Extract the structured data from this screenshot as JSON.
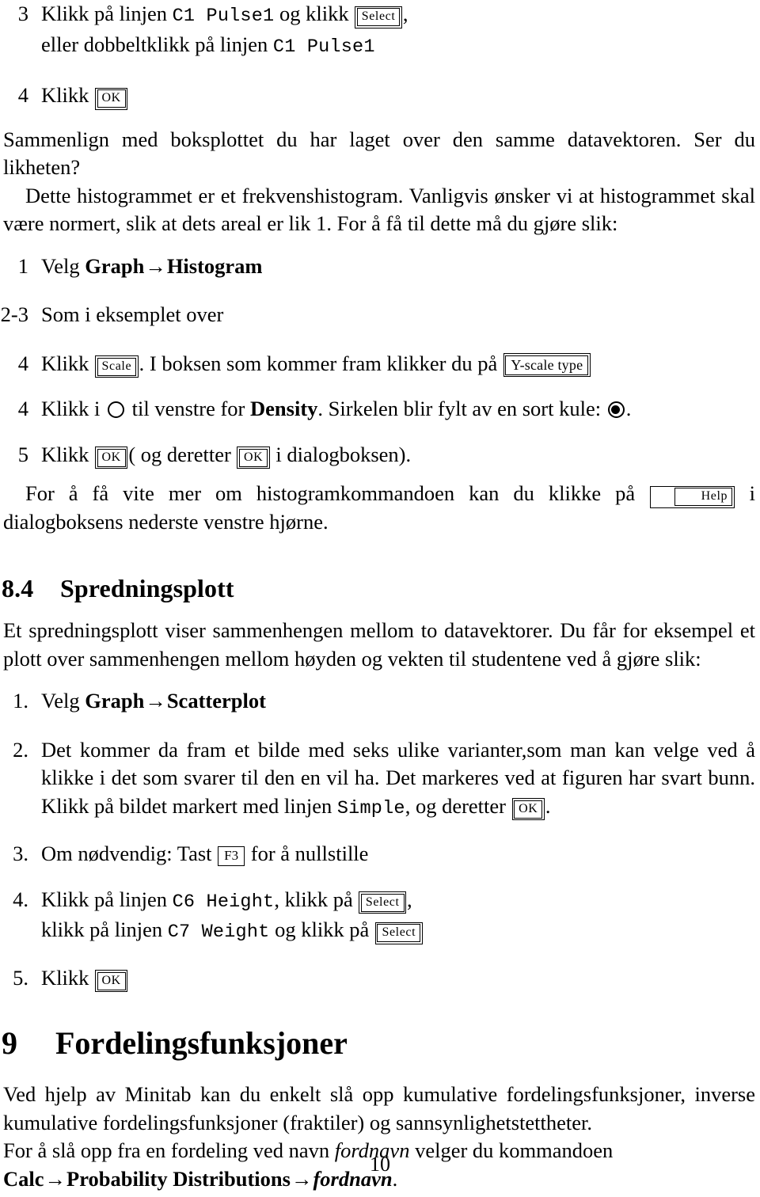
{
  "document": {
    "page_number": "10",
    "language": "Norwegian"
  },
  "top_list": {
    "items": [
      {
        "marker": "3",
        "line1_pre": "Klikk på linjen ",
        "line1_mono": "C1 Pulse1",
        "line1_mid": " og klikk ",
        "button": "Select",
        "line1_post": ",",
        "line2_pre": "eller dobbeltklikk på linjen ",
        "line2_mono": "C1 Pulse1"
      },
      {
        "marker": "4",
        "text_pre": "Klikk ",
        "button": "OK"
      }
    ]
  },
  "paragraphs": {
    "compare": "Sammenlign med boksplottet du har laget over den samme datavektoren. Ser du likheten?",
    "frequency": "Dette histogrammet er et frekvenshistogram. Vanligvis ønsker vi at histogrammet skal være normert, slik at dets areal er lik 1. For å få til dette må du gjøre slik:",
    "help_pre": "For å få vite mer om histogramkommandoen kan du klikke på ",
    "help_button": "Help",
    "help_post": " i dialogboksens nederste venstre hjørne."
  },
  "histogram_steps": {
    "items": [
      {
        "marker": "1",
        "pre": "Velg ",
        "bold1": "Graph",
        "arrow": "→",
        "bold2": "Histogram"
      },
      {
        "marker": "2-3",
        "text": "Som i eksemplet over"
      },
      {
        "marker": "4",
        "pre": "Klikk ",
        "button1": "Scale",
        "mid": ". I boksen som kommer fram klikker du på ",
        "button2": "Y-scale type"
      },
      {
        "marker": "4",
        "pre": "Klikk i ",
        "radio_empty": "radio-empty-icon",
        "mid": " til venstre for ",
        "bold": "Density",
        "mid2": ". Sirkelen blir fylt av en sort kule: ",
        "radio_filled": "radio-filled-icon",
        "post": "."
      },
      {
        "marker": "5",
        "pre": "Klikk ",
        "button1": "OK",
        "mid": "( og deretter ",
        "button2": "OK",
        "post": " i dialogboksen)."
      }
    ]
  },
  "section": {
    "number": "8.4",
    "title": "Spredningsplott",
    "intro": "Et spredningsplott viser sammenhengen mellom to datavektorer. Du får for eksempel et plott over sammenhengen mellom høyden og vekten til studentene ved å gjøre slik:"
  },
  "scatter_steps": {
    "items": [
      {
        "marker": "1.",
        "pre": "Velg ",
        "bold1": "Graph",
        "arrow": "→",
        "bold2": "Scatterplot"
      },
      {
        "marker": "2.",
        "text_pre": "Det kommer da fram et bilde med seks ulike varianter,som man kan velge ved å klikke i det som svarer til den en vil ha. Det markeres ved at figuren har svart bunn. Klikk på bildet markert med linjen ",
        "mono": "Simple",
        "text_mid": ", og deretter ",
        "button": "OK",
        "text_post": "."
      },
      {
        "marker": "3.",
        "pre": "Om nødvendig: Tast ",
        "key": "F3",
        "post": " for å nullstille"
      },
      {
        "marker": "4.",
        "line1_pre": "Klikk på linjen ",
        "line1_mono": "C6 Height",
        "line1_mid": ", klikk på ",
        "line1_button": "Select",
        "line1_post": ",",
        "line2_pre": "klikk på linjen ",
        "line2_mono": "C7 Weight",
        "line2_mid": " og klikk på ",
        "line2_button": "Select"
      },
      {
        "marker": "5.",
        "pre": "Klikk ",
        "button": "OK"
      }
    ]
  },
  "chapter": {
    "number": "9",
    "title": "Fordelingsfunksjoner",
    "intro": "Ved hjelp av Minitab kan du enkelt slå opp kumulative fordelingsfunksjoner, inverse kumulative fordelingsfunksjoner (fraktiler) og sannsynlighetstettheter.",
    "command_pre": "For å slå opp fra en fordeling ved navn ",
    "command_ital1": "fordnavn",
    "command_mid": " velger du kommandoen ",
    "command_bold1": "Calc",
    "arrow1": "→",
    "command_bold2": "Probability Distributions",
    "arrow2": "→",
    "command_ital2": "fordnavn",
    "command_post": "."
  }
}
